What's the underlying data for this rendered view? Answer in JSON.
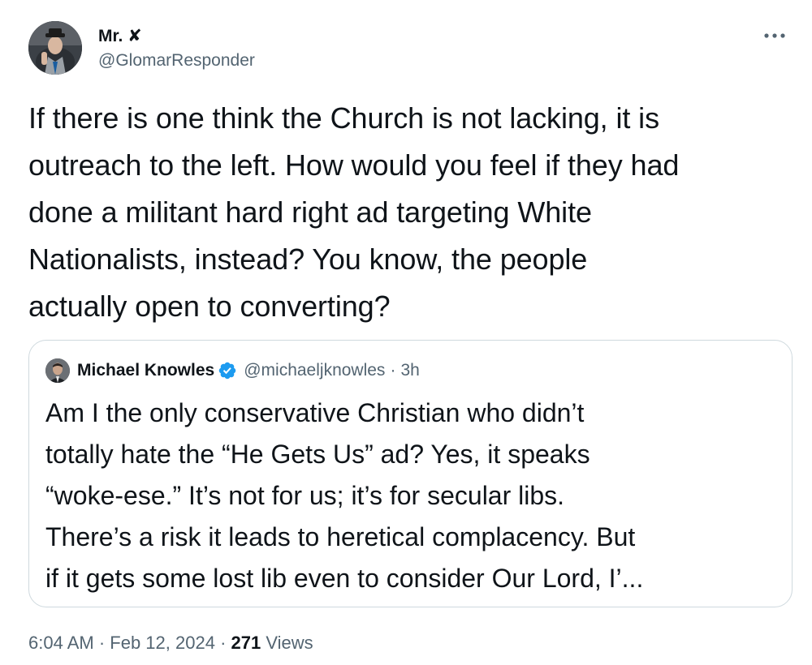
{
  "author": {
    "name": "Mr. ✘",
    "handle": "@GlomarResponder"
  },
  "more_icon": "more-horizontal-icon",
  "tweet": {
    "text": "If there is one think the Church is not lacking, it is\noutreach to the left. How would you feel if they had\ndone a militant hard right ad targeting White\nNationalists, instead?  You know, the people\nactually open to converting?"
  },
  "quoted_tweet": {
    "name": "Michael Knowles",
    "verified_icon": "verified-badge-icon",
    "handle": "@michaeljknowles",
    "separator": "·",
    "time": "3h",
    "text": "Am I the only conservative Christian who didn’t\ntotally hate the “He Gets Us” ad? Yes, it speaks\n“woke-ese.” It’s not for us; it’s for secular libs.\nThere’s a risk it leads to heretical complacency. But\nif it gets some lost lib even to consider Our Lord, I’..."
  },
  "meta": {
    "time": "6:04 AM",
    "sep1": " · ",
    "date": "Feb 12, 2024",
    "sep2": " · ",
    "views_count": "271",
    "views_label": " Views"
  },
  "colors": {
    "text_primary": "#0f1419",
    "text_secondary": "#536471",
    "border": "#cfd9de",
    "verified": "#1d9bf0"
  }
}
